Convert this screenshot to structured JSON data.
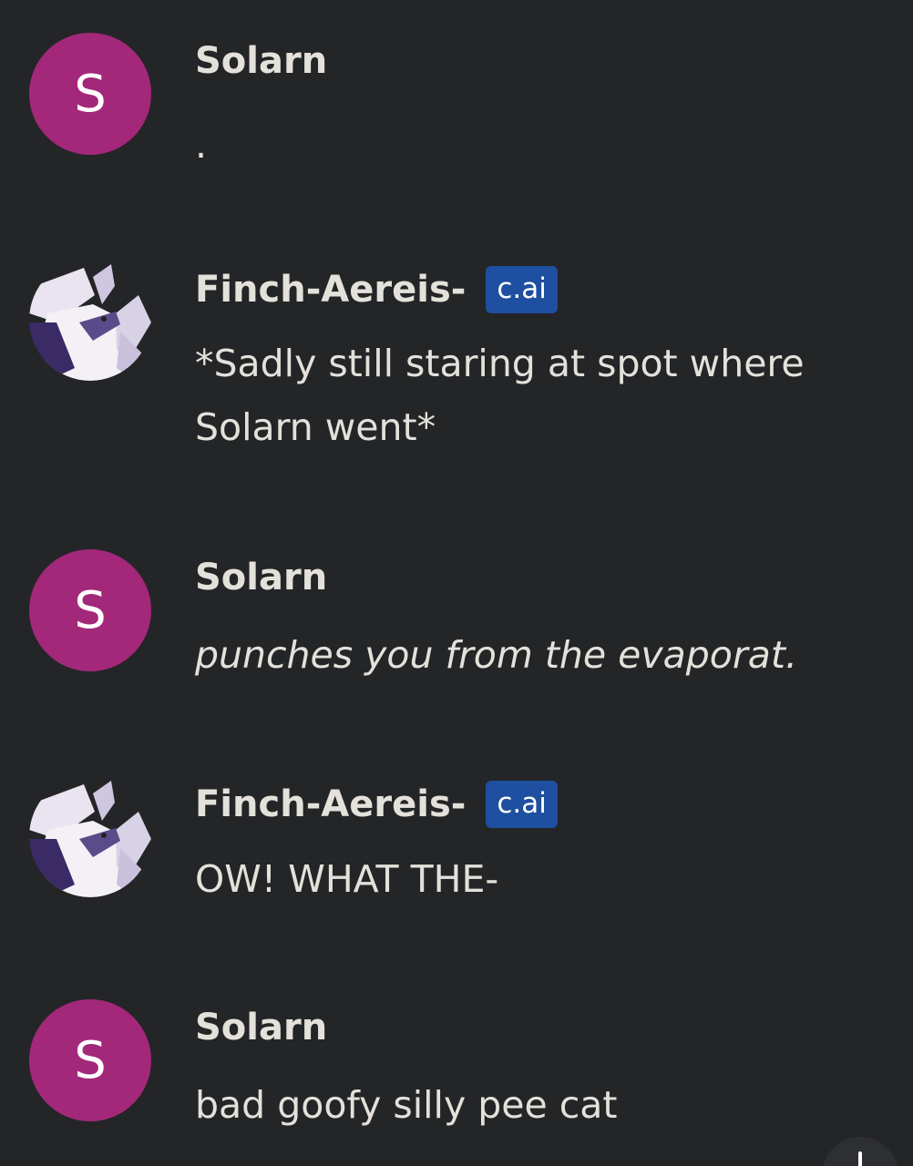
{
  "messages": [
    {
      "author": "Solarn",
      "avatar_letter": "S",
      "text": "."
    },
    {
      "author": "Finch-Aereis-",
      "badge": "c.ai",
      "text": "*Sadly still staring at spot where Solarn went*"
    },
    {
      "author": "Solarn",
      "avatar_letter": "S",
      "text": "punches you from the evaporat."
    },
    {
      "author": "Finch-Aereis-",
      "badge": "c.ai",
      "text": "OW! WHAT THE-"
    },
    {
      "author": "Solarn",
      "avatar_letter": "S",
      "text": "bad goofy silly pee cat"
    }
  ],
  "colors": {
    "background": "#242527",
    "user_avatar": "#a3287a",
    "badge": "#1e4fa0",
    "text": "#e4e1db"
  },
  "icons": {
    "scroll_down": "arrow-down-icon"
  }
}
